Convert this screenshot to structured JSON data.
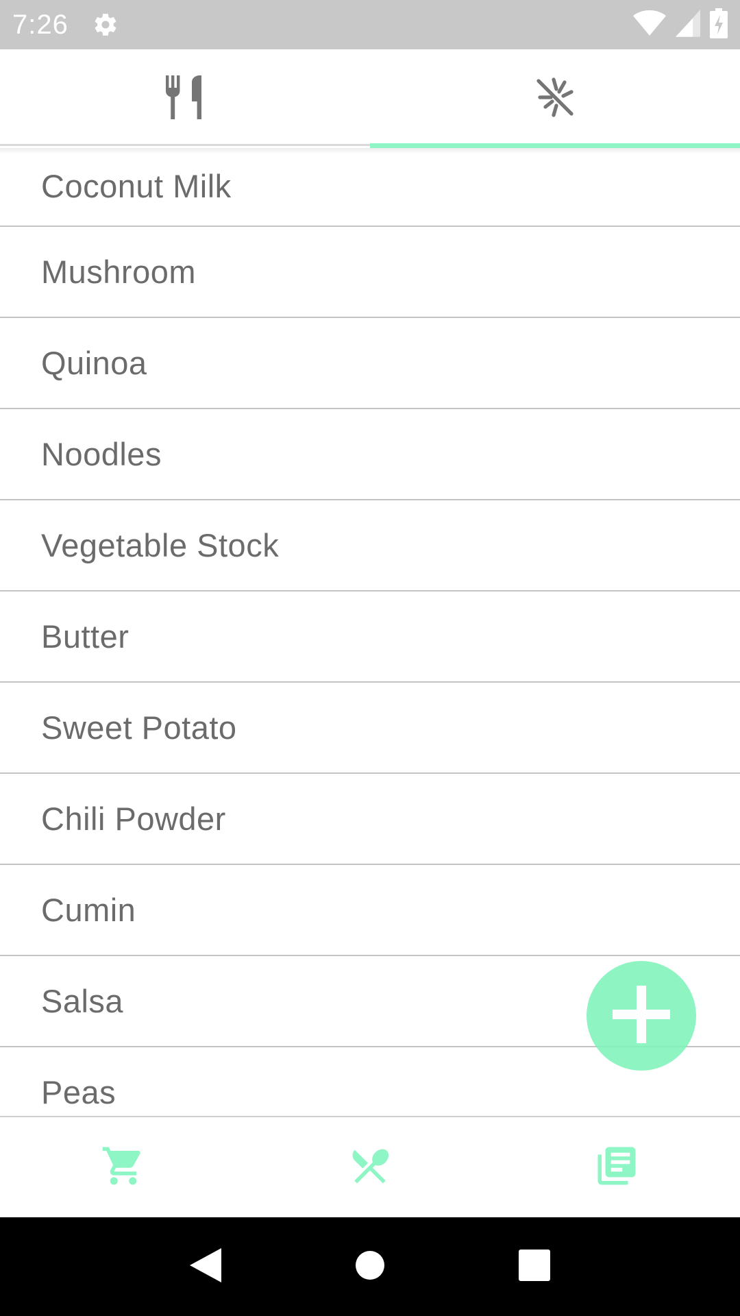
{
  "status_bar": {
    "time": "7:26",
    "icons": [
      "gear-icon",
      "wifi-icon",
      "signal-icon",
      "battery-charging-icon"
    ]
  },
  "top_tabs": [
    {
      "icon": "fork-knife-icon",
      "selected": false
    },
    {
      "icon": "no-ingredients-icon",
      "selected": true
    }
  ],
  "list": {
    "items": [
      "Coconut Milk",
      "Mushroom",
      "Quinoa",
      "Noodles",
      "Vegetable Stock",
      "Butter",
      "Sweet Potato",
      "Chili Powder",
      "Cumin",
      "Salsa",
      "Peas"
    ]
  },
  "fab": {
    "icon": "plus-icon"
  },
  "bottom_nav": [
    {
      "icon": "cart-icon"
    },
    {
      "icon": "utensils-cross-icon"
    },
    {
      "icon": "recipe-list-icon"
    }
  ],
  "colors": {
    "accent": "#8ef5c5",
    "status_bar": "#c8c8c8",
    "text": "#6b6b6b",
    "icon_gray": "#757575"
  }
}
